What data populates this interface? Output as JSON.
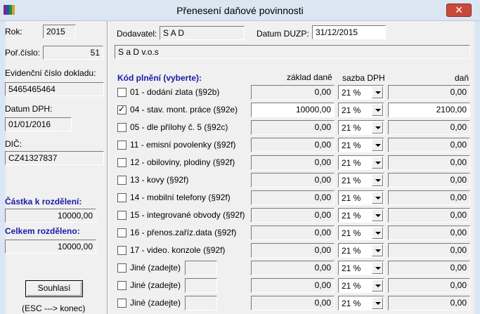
{
  "window": {
    "title": "Přenesení daňové povinnosti",
    "close_glyph": "✕"
  },
  "left": {
    "rok_label": "Rok:",
    "rok_value": "2015",
    "por_cislo_label": "Poř.číslo:",
    "por_cislo_value": "51",
    "evid_label": "Evidenční číslo dokladu:",
    "evid_value": "5465465464",
    "datum_dph_label": "Datum DPH:",
    "datum_dph_value": "01/01/2016",
    "dic_label": "DIČ:",
    "dic_value": "CZ41327837",
    "castka_label": "Částka k rozdělení:",
    "castka_value": "10000,00",
    "celkem_label": "Celkem rozděleno:",
    "celkem_value": "10000,00",
    "souhlasi_label": "Souhlasí",
    "esc_hint": "(ESC ---> konec)"
  },
  "header": {
    "dodavatel_label": "Dodavatel:",
    "dodavatel_value": "S A D",
    "duzp_label": "Datum DUZP:",
    "duzp_value": "31/12/2015",
    "supplier_name": "S a D v.o.s"
  },
  "table": {
    "kod_header": "Kód plnění (vyberte):",
    "zaklad_header": "základ daně",
    "sazba_header": "sazba DPH",
    "dan_header": "daň",
    "rows": [
      {
        "label": "01 - dodání zlata (§92b)",
        "checked": false,
        "zaklad": "0,00",
        "sazba": "21 %",
        "dan": "0,00"
      },
      {
        "label": "04 - stav. mont. práce (§92e)",
        "checked": true,
        "zaklad": "10000,00",
        "sazba": "21 %",
        "dan": "2100,00"
      },
      {
        "label": "05 - dle přílohy č. 5 (§92c)",
        "checked": false,
        "zaklad": "0,00",
        "sazba": "21 %",
        "dan": "0,00"
      },
      {
        "label": "11 - emisní povolenky (§92f)",
        "checked": false,
        "zaklad": "0,00",
        "sazba": "21 %",
        "dan": "0,00"
      },
      {
        "label": "12 - obiloviny, plodiny (§92f)",
        "checked": false,
        "zaklad": "0,00",
        "sazba": "21 %",
        "dan": "0,00"
      },
      {
        "label": "13 - kovy (§92f)",
        "checked": false,
        "zaklad": "0,00",
        "sazba": "21 %",
        "dan": "0,00"
      },
      {
        "label": "14 - mobilní telefony (§92f)",
        "checked": false,
        "zaklad": "0,00",
        "sazba": "21 %",
        "dan": "0,00"
      },
      {
        "label": "15 - integrované obvody (§92f)",
        "checked": false,
        "zaklad": "0,00",
        "sazba": "21 %",
        "dan": "0,00"
      },
      {
        "label": "16 - přenos.zaříz.data (§92f)",
        "checked": false,
        "zaklad": "0,00",
        "sazba": "21 %",
        "dan": "0,00"
      },
      {
        "label": "17 - video. konzole (§92f)",
        "checked": false,
        "zaklad": "0,00",
        "sazba": "21 %",
        "dan": "0,00"
      },
      {
        "label": "Jiné (zadejte)",
        "checked": false,
        "zaklad": "0,00",
        "sazba": "21 %",
        "dan": "0,00",
        "custom_code": ""
      },
      {
        "label": "Jiné (zadejte)",
        "checked": false,
        "zaklad": "0,00",
        "sazba": "21 %",
        "dan": "0,00",
        "custom_code": ""
      },
      {
        "label": "Jiné (zadejte)",
        "checked": false,
        "zaklad": "0,00",
        "sazba": "21 %",
        "dan": "0,00",
        "custom_code": ""
      }
    ]
  }
}
